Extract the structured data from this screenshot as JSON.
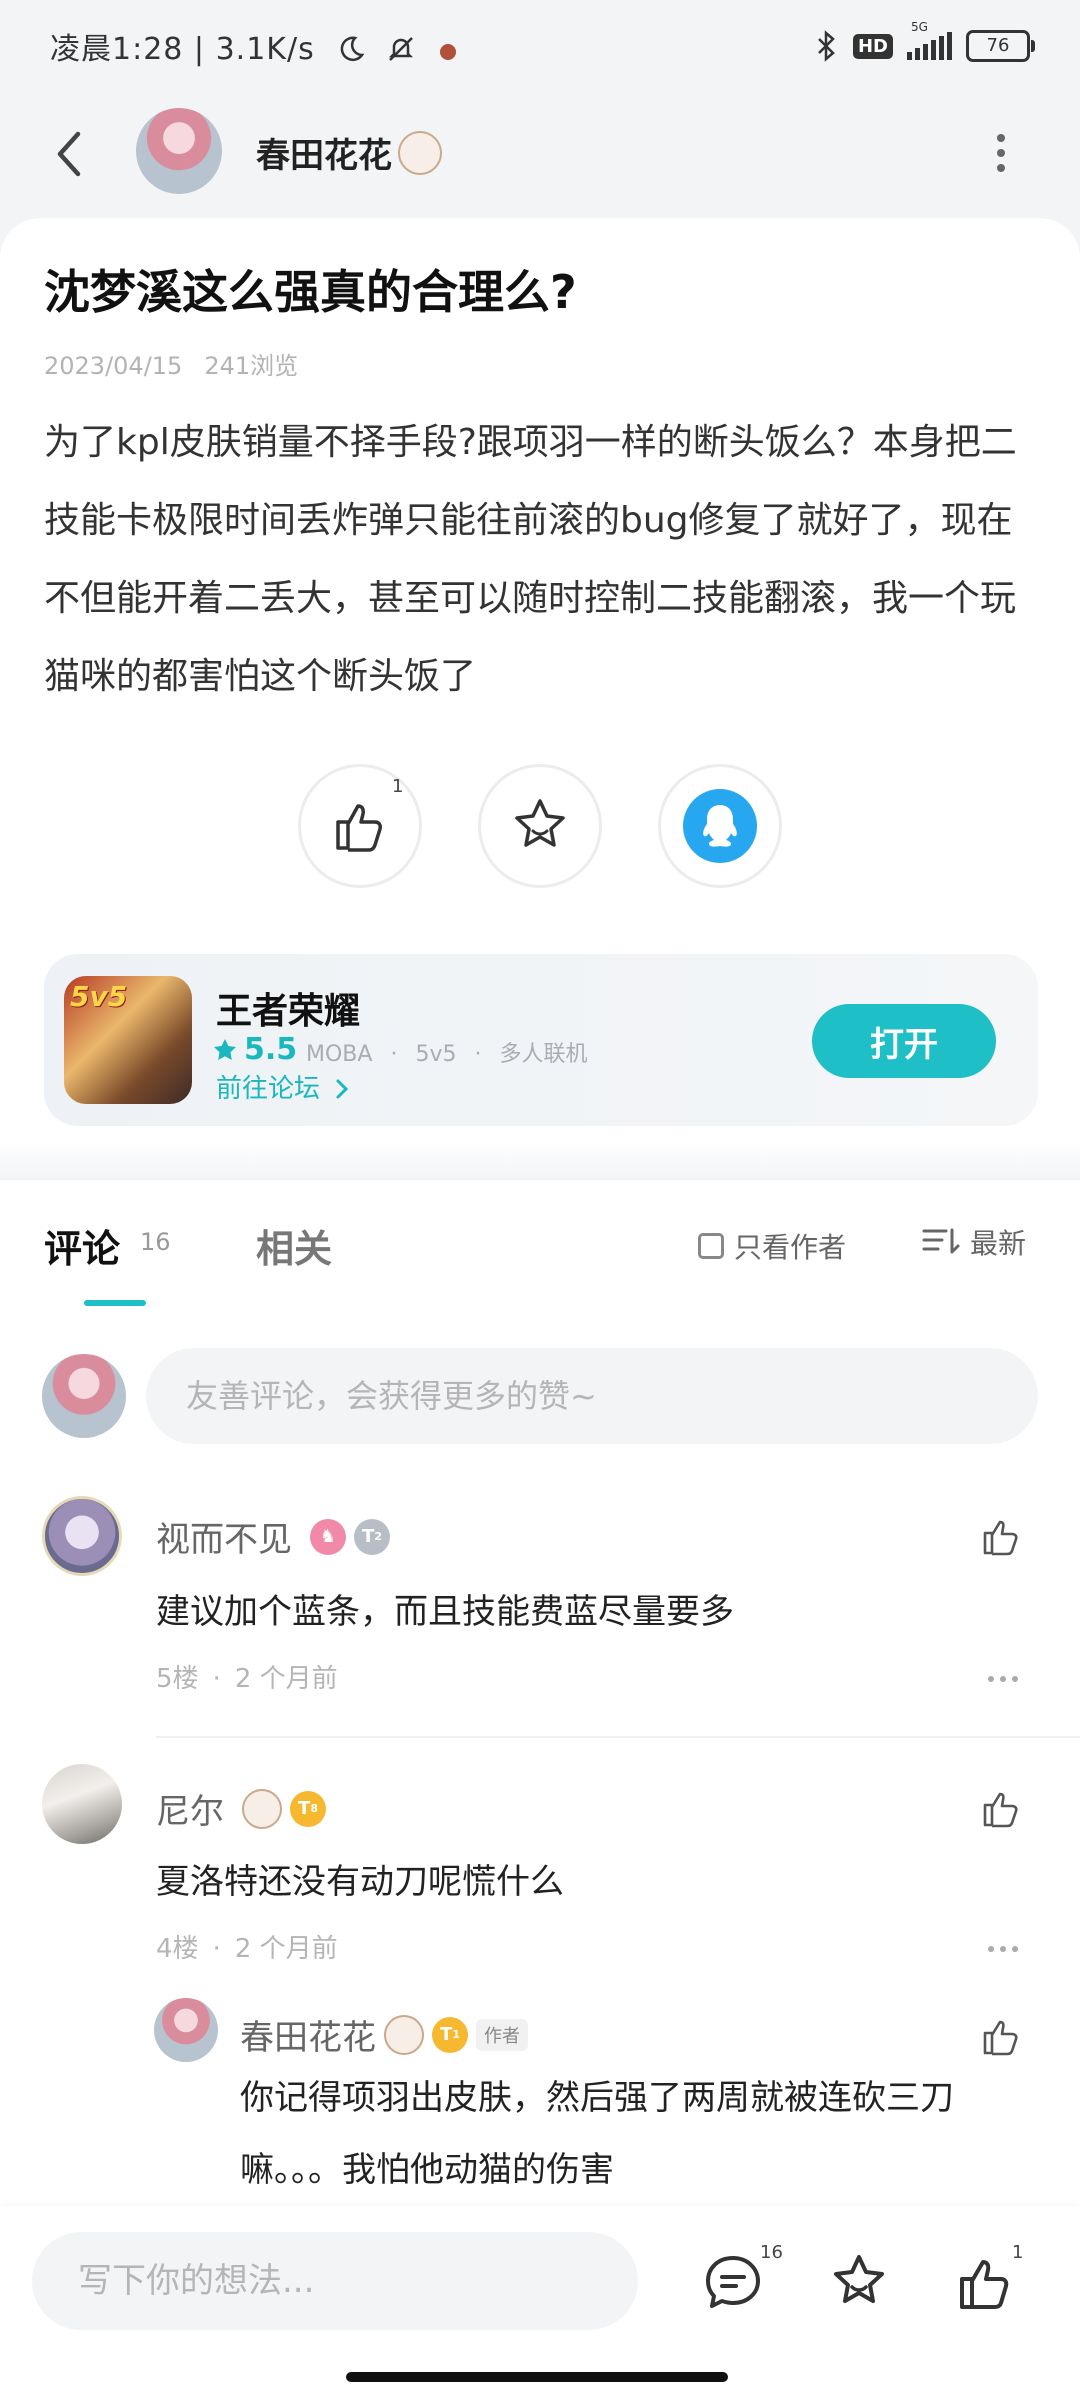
{
  "status_bar": {
    "time": "凌晨1:28",
    "net_speed": "3.1K/s",
    "network": "5G",
    "hd": "HD",
    "battery": "76"
  },
  "header": {
    "author_name": "春田花花"
  },
  "post": {
    "title": "沈梦溪这么强真的合理么?",
    "date": "2023/04/15",
    "views": "241浏览",
    "body": "为了kpl皮肤销量不择手段?跟项羽一样的断头饭么？本身把二技能卡极限时间丢炸弹只能往前滚的bug修复了就好了，现在不但能开着二丢大，甚至可以随时控制二技能翻滚，我一个玩猫咪的都害怕这个断头饭了",
    "like_count": "1"
  },
  "game": {
    "name": "王者荣耀",
    "icon_text": "5v5",
    "rating": "5.5",
    "tags": [
      "MOBA",
      "·",
      "5v5",
      "·",
      "多人联机"
    ],
    "forum_link": "前往论坛",
    "open_label": "打开"
  },
  "tabs": {
    "comments_label": "评论",
    "comments_count": "16",
    "related_label": "相关",
    "author_only_label": "只看作者",
    "sort_label": "最新"
  },
  "comment_input": {
    "placeholder": "友善评论，会获得更多的赞~"
  },
  "comments": [
    {
      "name": "视而不见",
      "level": "2",
      "text": "建议加个蓝条，而且技能费蓝尽量要多",
      "floor": "5楼",
      "sep": "·",
      "time": "2 个月前"
    },
    {
      "name": "尼尔",
      "level": "8",
      "text": "夏洛特还没有动刀呢慌什么",
      "floor": "4楼",
      "sep": "·",
      "time": "2 个月前"
    }
  ],
  "reply": {
    "name": "春田花花",
    "level": "1",
    "author_tag": "作者",
    "text_line1": "你记得项羽出皮肤，然后强了两周就被连砍三刀",
    "text_line2": "嘛。。。我怕他动猫的伤害"
  },
  "bottom_bar": {
    "placeholder": "写下你的想法...",
    "comment_count": "16",
    "like_count": "1"
  },
  "colors": {
    "accent": "#1fbfc7",
    "level_gold": "#f5b82e",
    "level_gray": "#b8bec6",
    "qq_blue": "#27a7f0"
  }
}
